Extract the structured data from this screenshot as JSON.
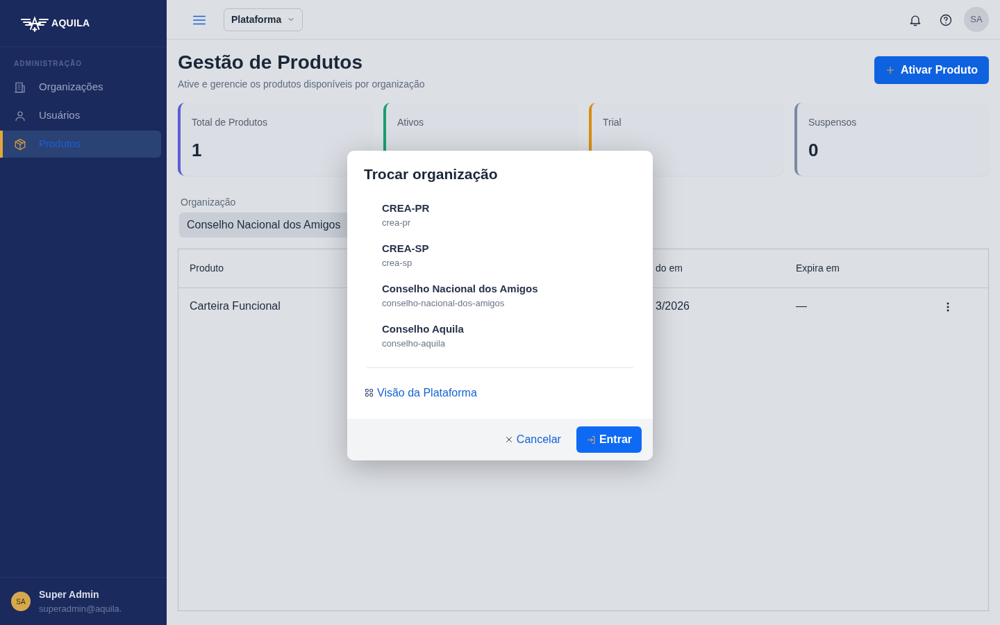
{
  "brand": {
    "name": "AQUILA"
  },
  "sidebar": {
    "section": "ADMINISTRAÇÃO",
    "items": [
      {
        "label": "Organizações",
        "selected": false
      },
      {
        "label": "Usuários",
        "selected": false
      },
      {
        "label": "Produtos",
        "selected": true
      }
    ]
  },
  "user": {
    "initials": "SA",
    "name": "Super Admin",
    "email": "superadmin@aquila."
  },
  "topbar": {
    "context": "Plataforma",
    "avatar": "SA"
  },
  "page": {
    "title": "Gestão de Produtos",
    "subtitle": "Ative e gerencie os produtos disponíveis por organização",
    "primary_button": "Ativar Produto"
  },
  "stats": [
    {
      "label": "Total de Produtos",
      "value": "1",
      "color": "#5b5bd6"
    },
    {
      "label": "Ativos",
      "color": "#1a9e6e"
    },
    {
      "label": "Trial",
      "color": "#d98e10"
    },
    {
      "label": "Suspensos",
      "value": "0",
      "color": "#7a8aa3"
    }
  ],
  "filter": {
    "label": "Organização",
    "value": "Conselho Nacional dos Amigos"
  },
  "table": {
    "columns": [
      "Produto",
      "do em",
      "Expira em"
    ],
    "rows": [
      {
        "cells": [
          "Carteira Funcional",
          "3/2026",
          "—"
        ]
      }
    ]
  },
  "modal": {
    "title": "Trocar organização",
    "options": [
      {
        "name": "CREA-PR",
        "slug": "crea-pr",
        "selected": false
      },
      {
        "name": "CREA-SP",
        "slug": "crea-sp",
        "selected": false
      },
      {
        "name": "Conselho Nacional dos Amigos",
        "slug": "conselho-nacional-dos-amigos",
        "selected": false
      },
      {
        "name": "Conselho Aquila",
        "slug": "conselho-aquila",
        "selected": false
      }
    ],
    "platform_link": "Visão da Plataforma",
    "cancel": "Cancelar",
    "confirm": "Entrar"
  }
}
